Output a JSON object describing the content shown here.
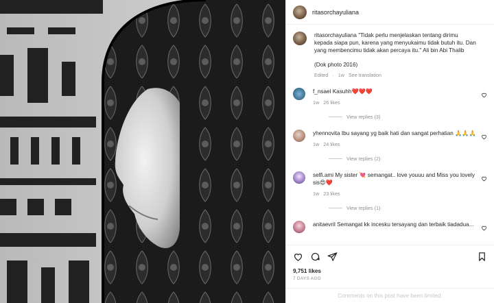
{
  "post": {
    "username": "ritasorchayuliana",
    "caption": "\"Tidak perlu menjelaskan tentang dirimu kepada siapa pun, karena yang menyukaimu tidak butuh itu. Dan yang membencimu tidak akan percaya itu.\" Ali bin Abi Thalib",
    "dok": "(Dok photo 2016)",
    "edited": "Edited",
    "caption_time": "1w",
    "see_translation": "See translation",
    "likes": "9,751 likes",
    "date": "7 DAYS AGO",
    "comments_limited": "Comments on this post have been limited."
  },
  "comments": [
    {
      "username": "f_nsael",
      "text": "Kasuhh❤️❤️❤️",
      "time": "1w",
      "likes": "26 likes",
      "replies": "View replies (3)"
    },
    {
      "username": "yhennovita",
      "text": "Ibu sayang yg baik hati dan sangat perhatian 🙏🙏🙏",
      "time": "1w",
      "likes": "24 likes",
      "replies": "View replies (2)"
    },
    {
      "username": "selfi.ami",
      "text": "My sister 💘 semangat.. love youuu and Miss you lovely sis😍❤️",
      "time": "1w",
      "likes": "23 likes",
      "replies": "View replies (1)"
    },
    {
      "username": "anitaevril",
      "text": "Semangat kk incesku tersayang dan terbaik tiadadua...",
      "time": "",
      "likes": "",
      "replies": ""
    }
  ],
  "icons": [
    "heart-icon",
    "comment-icon",
    "share-icon",
    "bookmark-icon"
  ],
  "colors": {
    "text": "#262626",
    "muted": "#8e8e8e",
    "heart": "#ed4956"
  }
}
